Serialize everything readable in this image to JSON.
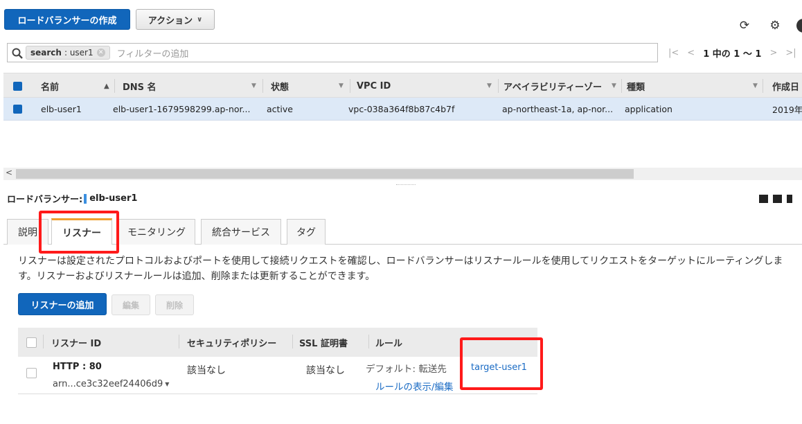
{
  "toolbar": {
    "create_label": "ロードバランサーの作成",
    "actions_label": "アクション",
    "actions_icon": "chevron-down-icon",
    "icons": [
      "refresh-icon",
      "gear-icon",
      "help-icon"
    ]
  },
  "search": {
    "chip_key": "search",
    "chip_value": "user1",
    "placeholder": "フィルターの追加"
  },
  "pager": {
    "first": "|<",
    "prev": "<",
    "summary": "1 中の 1 ～ 1",
    "next": ">",
    "last": ">|"
  },
  "table": {
    "headers": {
      "name": "名前",
      "dns": "DNS 名",
      "state": "状態",
      "vpc": "VPC ID",
      "az": "アベイラビリティーゾー",
      "type": "種類",
      "created": "作成日"
    },
    "rows": [
      {
        "name": "elb-user1",
        "dns": "elb-user1-1679598299.ap-nor...",
        "state": "active",
        "vpc": "vpc-038a364f8b87c4b7f",
        "az": "ap-northeast-1a, ap-nor...",
        "type": "application",
        "created": "2019年"
      }
    ]
  },
  "detail": {
    "label": "ロードバランサー:",
    "name": "elb-user1",
    "tabs": [
      "説明",
      "リスナー",
      "モニタリング",
      "統合サービス",
      "タグ"
    ],
    "active_tab": "リスナー",
    "description": "リスナーは設定されたプロトコルおよびポートを使用して接続リクエストを確認し、ロードバランサーはリスナールールを使用してリクエストをターゲットにルーティングします。リスナーおよびリスナールールは追加、削除または更新することができます。",
    "buttons": {
      "add": "リスナーの追加",
      "edit": "編集",
      "delete": "削除"
    },
    "listeners": {
      "headers": {
        "id": "リスナー ID",
        "policy": "セキュリティポリシー",
        "ssl": "SSL 証明書",
        "rule": "ルール"
      },
      "rows": [
        {
          "id": "HTTP : 80",
          "arn": "arn...ce3c32eef24406d9",
          "policy": "該当なし",
          "ssl": "該当なし",
          "default_label": "デフォルト: 転送先",
          "target": "target-user1",
          "rule_link": "ルールの表示/編集"
        }
      ]
    }
  },
  "colors": {
    "primary": "#1166bb",
    "link": "#1a6bc4",
    "highlight": "#ff1a1a",
    "selected_row": "#dde9f7",
    "tab_accent": "#f0a030"
  }
}
